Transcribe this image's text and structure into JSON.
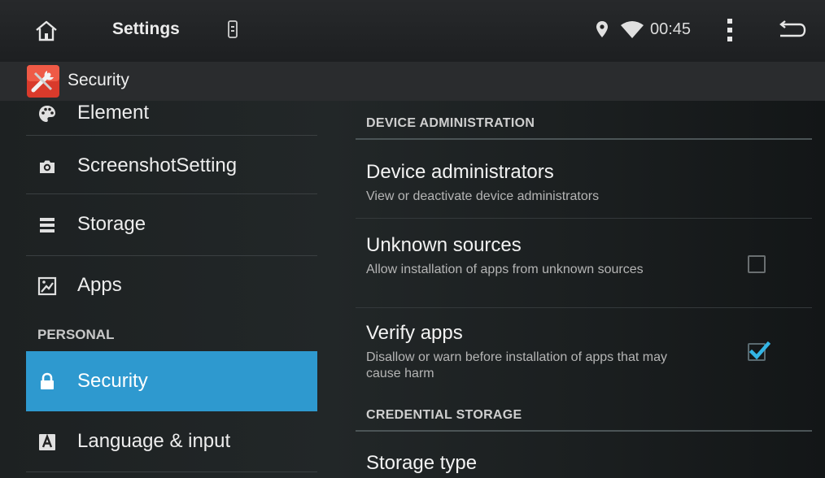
{
  "statusbar": {
    "title": "Settings",
    "time": "00:45",
    "icons": [
      "home-icon",
      "sd-card-icon",
      "location-icon",
      "wifi-icon",
      "overflow-menu-icon",
      "back-icon"
    ]
  },
  "actionbar": {
    "title": "Security",
    "icon": "settings-tools-icon"
  },
  "nav": {
    "items_top": [
      {
        "label": "Element",
        "icon": "palette-icon"
      },
      {
        "label": "ScreenshotSetting",
        "icon": "camera-icon"
      },
      {
        "label": "Storage",
        "icon": "storage-icon"
      },
      {
        "label": "Apps",
        "icon": "apps-icon"
      }
    ],
    "section_personal": "PERSONAL",
    "items_personal": [
      {
        "label": "Security",
        "icon": "lock-icon",
        "selected": true
      },
      {
        "label": "Language & input",
        "icon": "keyboard-a-icon"
      }
    ],
    "selected_color": "#2e99cf"
  },
  "security": {
    "device_admin_header": "DEVICE ADMINISTRATION",
    "device_admins": {
      "title": "Device administrators",
      "summary": "View or deactivate device administrators"
    },
    "unknown_sources": {
      "title": "Unknown sources",
      "summary": "Allow installation of apps from unknown sources",
      "checked": false
    },
    "verify_apps": {
      "title": "Verify apps",
      "summary": "Disallow or warn before installation of apps that may cause harm",
      "checked": true
    },
    "credential_header": "CREDENTIAL STORAGE",
    "storage_type": {
      "title": "Storage type"
    },
    "accent_color": "#33b5e5"
  }
}
